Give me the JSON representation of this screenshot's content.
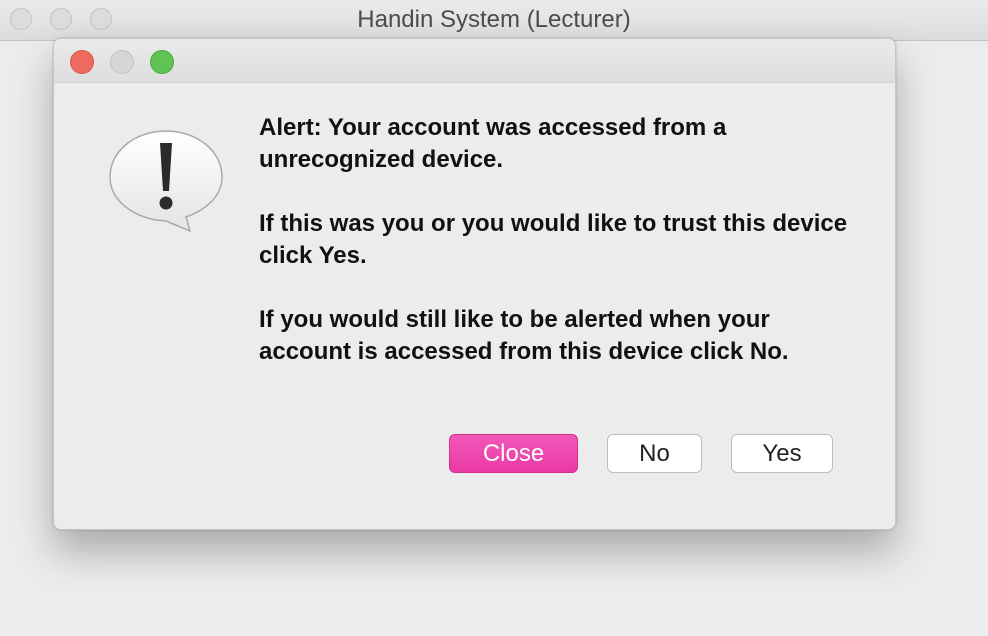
{
  "parent_window": {
    "title": "Handin System (Lecturer)"
  },
  "dialog": {
    "icon": "alert-speech-bubble-icon",
    "message": [
      "Alert: Your account was accessed from a unrecognized device.",
      "If this was you or you would like to trust this device click Yes.",
      "If you would still like to be alerted when your account is accessed from this device click No."
    ],
    "buttons": {
      "close_label": "Close",
      "no_label": "No",
      "yes_label": "Yes"
    }
  },
  "colors": {
    "accent": "#ea3fa6",
    "traffic_close": "#ee6a5f",
    "traffic_max": "#5fc454"
  }
}
